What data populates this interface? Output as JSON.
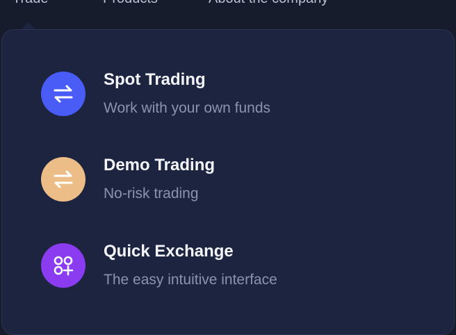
{
  "nav": {
    "items": [
      {
        "label": "Trade"
      },
      {
        "label": "Products"
      },
      {
        "label": "About the company"
      }
    ]
  },
  "menu": {
    "items": [
      {
        "title": "Spot Trading",
        "subtitle": "Work with your own funds",
        "icon": "swap-arrows-icon",
        "color": "#4a5cf6"
      },
      {
        "title": "Demo Trading",
        "subtitle": "No-risk trading",
        "icon": "swap-arrows-icon",
        "color": "#edbd87"
      },
      {
        "title": "Quick Exchange",
        "subtitle": "The easy intuitive interface",
        "icon": "circles-plus-icon",
        "color": "#8b3cf0"
      }
    ]
  }
}
